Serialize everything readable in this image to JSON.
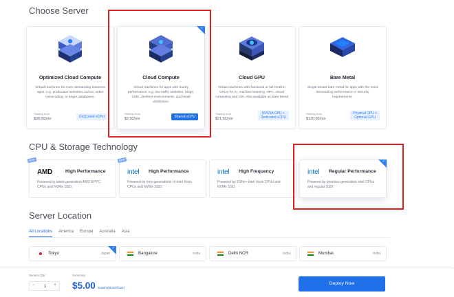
{
  "sections": {
    "choose_server": "Choose Server",
    "cpu_storage": "CPU & Storage Technology",
    "server_location": "Server Location"
  },
  "server_cards": [
    {
      "name": "Optimized Cloud Compute",
      "description": "Virtual machines for more demanding business apps, e.g. production websites, CI/CD, video transcoding, or larger databases.",
      "price_label": "Starting from",
      "price": "$28.00/mo",
      "badge": "Dedicated vCPU",
      "selected": false,
      "icon": "server-stack-icon"
    },
    {
      "name": "Cloud Compute",
      "description": "Virtual machines for apps with bursty performance, e.g. low traffic websites, blogs, CMS, dev/test environments, and small databases.",
      "price_label": "Starting from",
      "price": "$2.50/mo",
      "badge": "Shared vCPU",
      "selected": true,
      "icon": "cloud-server-icon"
    },
    {
      "name": "Cloud GPU",
      "description": "Virtual machines with fractional or full NVIDIA GPUs for AI, machine learning, HPC, visual computing and VDI. Also available as Bare Metal",
      "price_label": "Starting from",
      "price": "$21.50/mo",
      "badge_lines": [
        "NVIDIA GPU +",
        "Dedicated vCPU"
      ],
      "selected": false,
      "icon": "gpu-icon"
    },
    {
      "name": "Bare Metal",
      "description": "Single tenant bare metal for apps with the most demanding performance or security requirements.",
      "price_label": "Starting from",
      "price": "$120.00/mo",
      "badge_lines": [
        "Physical CPU +",
        "Optional GPU"
      ],
      "selected": false,
      "icon": "bare-metal-icon"
    }
  ],
  "cpu_cards": [
    {
      "brand": "AMD",
      "name": "High Performance",
      "description": "Powered by latest generation AMD EPYC CPUs and NVMe SSD.",
      "new": true,
      "new_label": "NEW",
      "selected": false
    },
    {
      "brand": "intel",
      "name": "High Performance",
      "description": "Powered by new generations of Intel Xeon CPUs and NVMe SSD.",
      "new": true,
      "new_label": "NEW",
      "selected": false
    },
    {
      "brand": "intel",
      "name": "High Frequency",
      "description": "Powered by 3GHz+ Intel Xeon CPUs and NVMe SSD.",
      "new": false,
      "selected": false
    },
    {
      "brand": "intel",
      "name": "Regular Performance",
      "description": "Powered by previous generation Intel CPUs and regular SSD.",
      "new": false,
      "selected": true
    }
  ],
  "location_tabs": [
    "All Locations",
    "America",
    "Europe",
    "Australia",
    "Asia"
  ],
  "active_tab": "All Locations",
  "locations": [
    {
      "name": "Tokyo",
      "country": "Japan",
      "flag": "japan",
      "selected": true
    },
    {
      "name": "Bangalore",
      "country": "India",
      "flag": "india",
      "selected": false
    },
    {
      "name": "Delhi NCR",
      "country": "India",
      "flag": "india",
      "selected": false
    },
    {
      "name": "Mumbai",
      "country": "India",
      "flag": "india",
      "selected": false
    }
  ],
  "footer": {
    "qty_label": "Servers Qty:",
    "qty_value": "1",
    "qty_minus": "−",
    "qty_plus": "+",
    "summary_label": "Summary:",
    "summary_price": "$5.00",
    "summary_note": "/month ($0.007/hour)",
    "deploy_label": "Deploy Now"
  },
  "colors": {
    "accent": "#1f6fe8",
    "highlight": "#e21f1f",
    "intel": "#0071c5",
    "new_tag": "#7ba9f3"
  }
}
